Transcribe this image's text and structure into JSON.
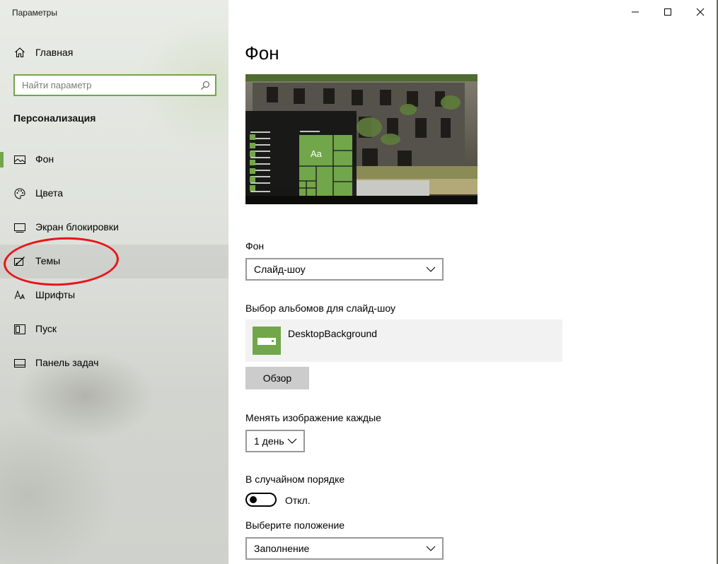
{
  "window": {
    "title": "Параметры",
    "caption": {
      "minimize": "minimize-icon",
      "maximize": "maximize-icon",
      "close": "close-icon"
    }
  },
  "sidebar": {
    "home_label": "Главная",
    "search_placeholder": "Найти параметр",
    "section_title": "Персонализация",
    "items": [
      {
        "label": "Фон",
        "icon": "picture-icon",
        "active": true
      },
      {
        "label": "Цвета",
        "icon": "palette-icon"
      },
      {
        "label": "Экран блокировки",
        "icon": "monitor-icon"
      },
      {
        "label": "Темы",
        "icon": "brush-icon",
        "hovered": true
      },
      {
        "label": "Шрифты",
        "icon": "font-icon"
      },
      {
        "label": "Пуск",
        "icon": "start-icon"
      },
      {
        "label": "Панель задач",
        "icon": "taskbar-icon"
      }
    ]
  },
  "main": {
    "title": "Фон",
    "preview_tile_text": "Aa",
    "background_label": "Фон",
    "background_value": "Слайд-шоу",
    "albums_label": "Выбор альбомов для слайд-шоу",
    "album_name": "DesktopBackground",
    "browse_button": "Обзор",
    "interval_label": "Менять изображение каждые",
    "interval_value": "1 день",
    "shuffle_label": "В случайном порядке",
    "shuffle_state": "Откл.",
    "fit_label": "Выберите положение",
    "fit_value": "Заполнение"
  },
  "colors": {
    "accent": "#72a64a",
    "annotation": "#e8141b"
  }
}
